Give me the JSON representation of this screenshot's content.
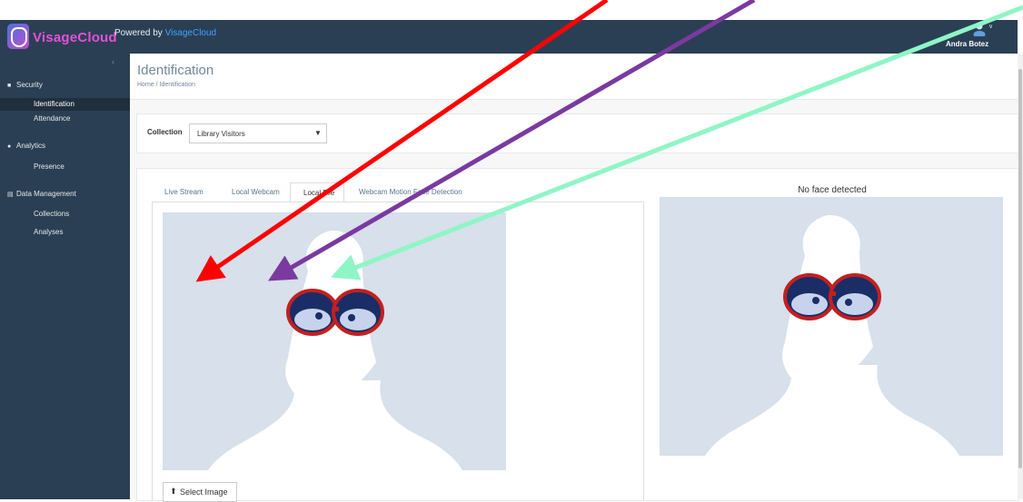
{
  "header": {
    "brand": "VisageCloud",
    "powered_prefix": "Powered by ",
    "powered_link": "VisageCloud",
    "user_name": "Andra Botez",
    "colors": {
      "bar": "#2a3f54",
      "brand": "#e84fd9",
      "link": "#3fa2ff"
    }
  },
  "sidebar": {
    "sections": [
      {
        "label": "Security",
        "icon": "camera-icon",
        "items": [
          "Identification",
          "Attendance"
        ]
      },
      {
        "label": "Analytics",
        "icon": "pie-icon",
        "items": [
          "Presence"
        ]
      },
      {
        "label": "Data Management",
        "icon": "table-icon",
        "items": [
          "Collections",
          "Analyses"
        ]
      }
    ],
    "active_item": "Identification"
  },
  "page": {
    "title": "Identification",
    "breadcrumb_home": "Home",
    "breadcrumb_sep": "/",
    "breadcrumb_current": "Identification"
  },
  "collection": {
    "label": "Collection",
    "selected": "Library Visitors"
  },
  "tabs": [
    "Live Stream",
    "Local Webcam",
    "Local File",
    "Webcam Motion Face Detection"
  ],
  "active_tab": "Local File",
  "select_image_label": "Select Image",
  "result_text": "No face detected",
  "annotation_arrow_colors": [
    "#ff0000",
    "#7a3aa0",
    "#8ff5c6"
  ]
}
